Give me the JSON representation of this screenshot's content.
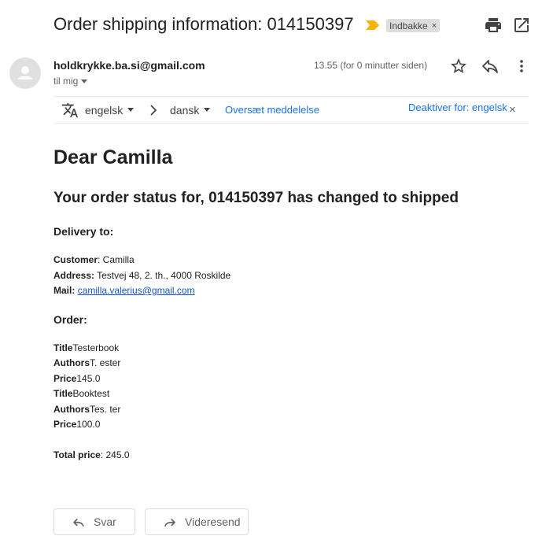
{
  "header": {
    "subject": "Order shipping information: 014150397",
    "label": "Indbakke",
    "label_remove": "×"
  },
  "message": {
    "sender": "holdkrykke.ba.si@gmail.com",
    "recipient": "til mig",
    "timestamp": "13.55 (for 0 minutter siden)"
  },
  "translate": {
    "from_lang": "engelsk",
    "to_lang": "dansk",
    "translate_link": "Oversæt meddelelse",
    "disable_link": "Deaktiver for: engelsk",
    "close": "×"
  },
  "body": {
    "greeting": "Dear Camilla",
    "status": "Your order status for, 014150397 has changed to shipped",
    "delivery_heading": "Delivery to:",
    "customer_label": "Customer",
    "customer_value": ": Camilla",
    "address_label": "Address:",
    "address_value": " Testvej 48, 2. th., 4000 Roskilde",
    "mail_label": "Mail:",
    "mail_value": "camilla.valerius@gmail.com",
    "order_heading": "Order:",
    "items": [
      {
        "title_label": "Title",
        "title": "Testerbook",
        "authors_label": "Authors",
        "authors": "T. ester",
        "price_label": "Price",
        "price": "145.0"
      },
      {
        "title_label": "Title",
        "title": "Booktest",
        "authors_label": "Authors",
        "authors": "Tes. ter",
        "price_label": "Price",
        "price": "100.0"
      }
    ],
    "total_label": "Total price",
    "total_value": ": 245.0"
  },
  "actions": {
    "reply": "Svar",
    "forward": "Videresend"
  },
  "colors": {
    "link": "#1155cc",
    "accent_link": "#1a73e8",
    "importance_marker": "#f4b400"
  },
  "icons": [
    "importance-marker-icon",
    "print-icon",
    "open-in-new-window-icon",
    "avatar-person-icon",
    "star-icon",
    "reply-icon",
    "more-vert-icon",
    "translate-icon",
    "chevron-right-icon",
    "forward-icon"
  ]
}
